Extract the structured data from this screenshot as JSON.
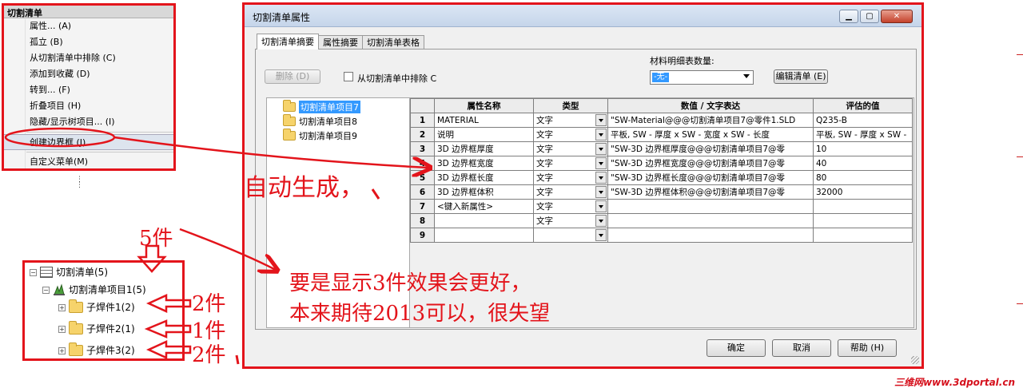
{
  "menu": {
    "title": "切割清单",
    "items": [
      {
        "label": "属性... (A)"
      },
      {
        "label": "孤立 (B)"
      },
      {
        "label": "从切割清单中排除 (C)"
      },
      {
        "label": "添加到收藏 (D)"
      },
      {
        "label": "转到... (F)"
      },
      {
        "label": "折叠项目 (H)"
      },
      {
        "label": "隐藏/显示树项目... (I)"
      },
      {
        "label": "创建边界框 (J)"
      },
      {
        "label": "自定义菜单(M)"
      }
    ]
  },
  "tree": {
    "root": "切割清单(5)",
    "item": "切割清单项目1(5)",
    "children": [
      {
        "label": "子焊件1(2)"
      },
      {
        "label": "子焊件2(1)"
      },
      {
        "label": "子焊件3(2)"
      }
    ]
  },
  "dialog": {
    "title": "切割清单属性",
    "tabs": [
      "切割清单摘要",
      "属性摘要",
      "切割清单表格"
    ],
    "delete_btn": "删除 (D)",
    "exclude_label": "从切割清单中排除 C",
    "bom_qty_label": "材料明细表数量:",
    "bom_qty_value": "-无-",
    "edit_list_btn": "编辑清单 (E)",
    "items": [
      "切割清单项目7",
      "切割清单项目8",
      "切割清单项目9"
    ],
    "grid": {
      "headers": [
        "",
        "属性名称",
        "类型",
        "数值 / 文字表达",
        "评估的值"
      ],
      "rows": [
        {
          "n": "1",
          "name": "MATERIAL",
          "type": "文字",
          "expr": "\"SW-Material@@@切割清单项目7@零件1.SLD",
          "val": "Q235-B"
        },
        {
          "n": "2",
          "name": "说明",
          "type": "文字",
          "expr": "平板, SW - 厚度 x SW - 宽度 x SW - 长度",
          "val": "平板, SW - 厚度 x SW -"
        },
        {
          "n": "3",
          "name": "3D 边界框厚度",
          "type": "文字",
          "expr": "\"SW-3D 边界框厚度@@@切割清单项目7@零",
          "val": "10"
        },
        {
          "n": "4",
          "name": "3D 边界框宽度",
          "type": "文字",
          "expr": "\"SW-3D 边界框宽度@@@切割清单项目7@零",
          "val": "40"
        },
        {
          "n": "5",
          "name": "3D 边界框长度",
          "type": "文字",
          "expr": "\"SW-3D 边界框长度@@@切割清单项目7@零",
          "val": "80"
        },
        {
          "n": "6",
          "name": "3D 边界框体积",
          "type": "文字",
          "expr": "\"SW-3D 边界框体积@@@切割清单项目7@零",
          "val": "32000"
        },
        {
          "n": "7",
          "name": "<键入新属性>",
          "type": "文字",
          "expr": "",
          "val": ""
        },
        {
          "n": "8",
          "name": "",
          "type": "文字",
          "expr": "",
          "val": ""
        },
        {
          "n": "9",
          "name": "",
          "type": "",
          "expr": "",
          "val": ""
        }
      ]
    },
    "ok": "确定",
    "cancel": "取消",
    "help": "帮助 (H)"
  },
  "annotations": {
    "auto_generate": "自动生成，",
    "five_parts": "5件",
    "two_parts_a": "2件",
    "one_part": "1件",
    "two_parts_b": "2件",
    "wish_line1": "要是显示3件效果会更好，",
    "wish_line2": "本来期待2013可以，很失望"
  },
  "watermark": "三维网www.3dportal.cn",
  "colors": {
    "annotation": "#e3141b",
    "selection": "#3399ff"
  }
}
